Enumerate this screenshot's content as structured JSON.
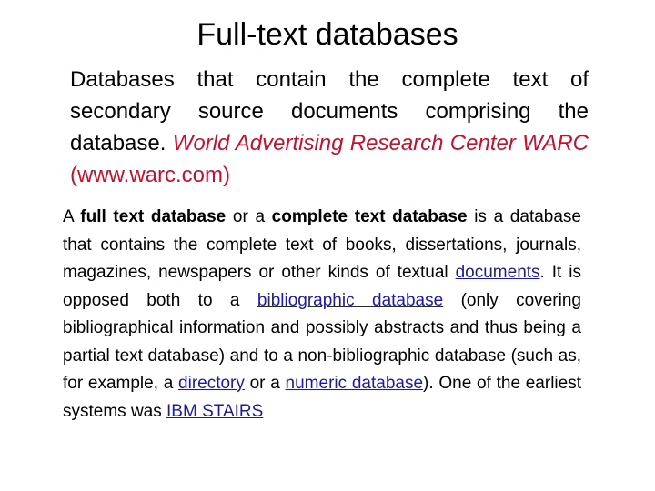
{
  "slide": {
    "title": "Full-text databases",
    "definition": {
      "text_black": "Databases that contain the complete text of secondary source documents comprising the database.",
      "text_red_italic": "World Advertising Research Center WARC",
      "text_red_plain": "(www.warc.com)"
    },
    "body": {
      "seg1": "A ",
      "bold1": "full text database",
      "seg2": " or a ",
      "bold2": "complete text database",
      "seg3": " is a database that contains the complete text of books, dissertations, journals, magazines, newspapers or other kinds of textual ",
      "link_documents": "documents",
      "seg4": ". It is opposed both to a ",
      "link_bibliographic": "bibliographic ",
      "seg5": " ",
      "link_database": "database",
      "seg6": " (only covering bibliographical information and possibly abstracts and thus being a partial text database) and to a non-bibliographic database (such as, for example, a ",
      "link_directory": "directory",
      "seg7": " or a ",
      "link_numeric_database": "numeric database",
      "seg8": "). One of the earliest systems was ",
      "link_ibm_stairs": "IBM STAIRS"
    }
  },
  "colors": {
    "accent_red": "#c8102e",
    "link_blue": "#1a1aa6",
    "text": "#000000",
    "background": "#ffffff"
  }
}
